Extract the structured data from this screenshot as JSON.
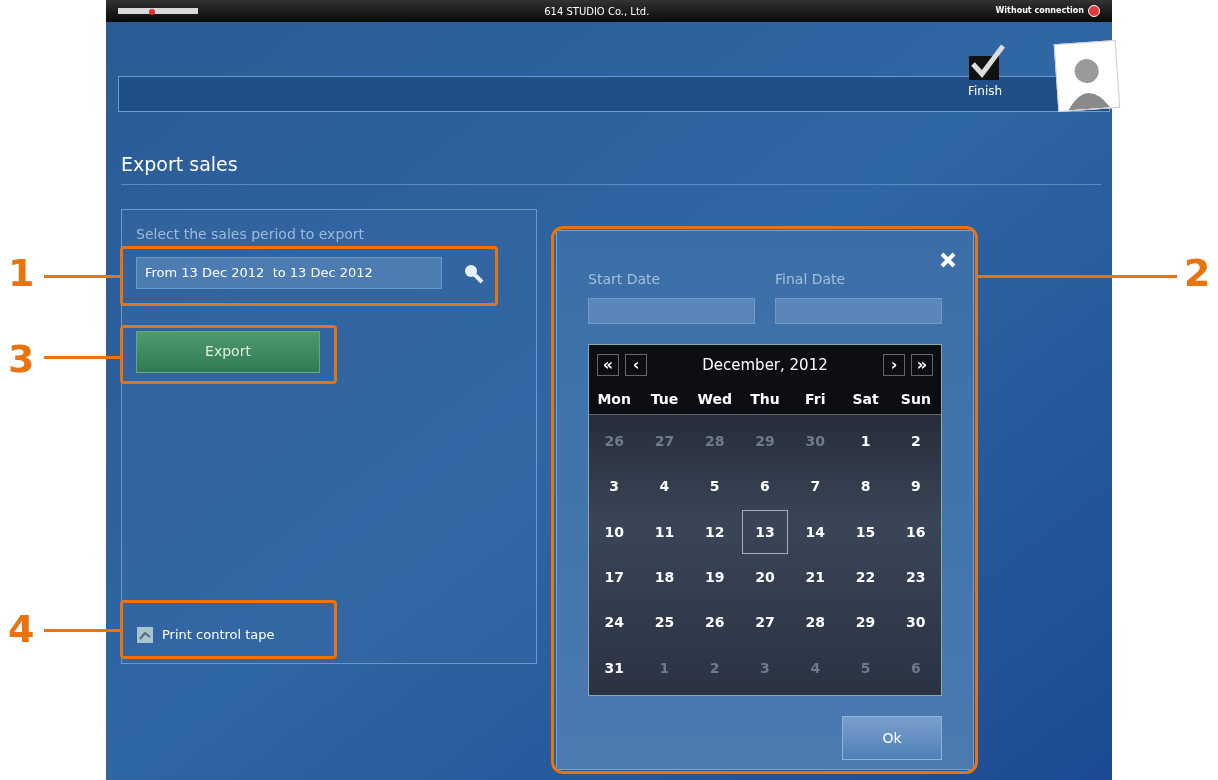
{
  "top_bar": {
    "company": "614 STUDIO Co., Ltd.",
    "connection": "Without connection"
  },
  "toolbar": {
    "finish": "Finish"
  },
  "page": {
    "title": "Export sales",
    "period_label": "Select the sales period to export",
    "period_value": "From 13 Dec 2012  to 13 Dec 2012",
    "export_button": "Export",
    "print_link": "Print control tape"
  },
  "date_popup": {
    "start_label": "Start Date",
    "final_label": "Final Date",
    "ok_button": "Ok",
    "calendar": {
      "first": "«",
      "prev": "‹",
      "month": "December, 2012",
      "next": "›",
      "last": "»",
      "weekdays": [
        "Mon",
        "Tue",
        "Wed",
        "Thu",
        "Fri",
        "Sat",
        "Sun"
      ],
      "weeks": [
        [
          {
            "day": "26",
            "outside": true,
            "selected": false
          },
          {
            "day": "27",
            "outside": true,
            "selected": false
          },
          {
            "day": "28",
            "outside": true,
            "selected": false
          },
          {
            "day": "29",
            "outside": true,
            "selected": false
          },
          {
            "day": "30",
            "outside": true,
            "selected": false
          },
          {
            "day": "1",
            "outside": false,
            "selected": false
          },
          {
            "day": "2",
            "outside": false,
            "selected": false
          }
        ],
        [
          {
            "day": "3",
            "outside": false,
            "selected": false
          },
          {
            "day": "4",
            "outside": false,
            "selected": false
          },
          {
            "day": "5",
            "outside": false,
            "selected": false
          },
          {
            "day": "6",
            "outside": false,
            "selected": false
          },
          {
            "day": "7",
            "outside": false,
            "selected": false
          },
          {
            "day": "8",
            "outside": false,
            "selected": false
          },
          {
            "day": "9",
            "outside": false,
            "selected": false
          }
        ],
        [
          {
            "day": "10",
            "outside": false,
            "selected": false
          },
          {
            "day": "11",
            "outside": false,
            "selected": false
          },
          {
            "day": "12",
            "outside": false,
            "selected": false
          },
          {
            "day": "13",
            "outside": false,
            "selected": true
          },
          {
            "day": "14",
            "outside": false,
            "selected": false
          },
          {
            "day": "15",
            "outside": false,
            "selected": false
          },
          {
            "day": "16",
            "outside": false,
            "selected": false
          }
        ],
        [
          {
            "day": "17",
            "outside": false,
            "selected": false
          },
          {
            "day": "18",
            "outside": false,
            "selected": false
          },
          {
            "day": "19",
            "outside": false,
            "selected": false
          },
          {
            "day": "20",
            "outside": false,
            "selected": false
          },
          {
            "day": "21",
            "outside": false,
            "selected": false
          },
          {
            "day": "22",
            "outside": false,
            "selected": false
          },
          {
            "day": "23",
            "outside": false,
            "selected": false
          }
        ],
        [
          {
            "day": "24",
            "outside": false,
            "selected": false
          },
          {
            "day": "25",
            "outside": false,
            "selected": false
          },
          {
            "day": "26",
            "outside": false,
            "selected": false
          },
          {
            "day": "27",
            "outside": false,
            "selected": false
          },
          {
            "day": "28",
            "outside": false,
            "selected": false
          },
          {
            "day": "29",
            "outside": false,
            "selected": false
          },
          {
            "day": "30",
            "outside": false,
            "selected": false
          }
        ],
        [
          {
            "day": "31",
            "outside": false,
            "selected": false
          },
          {
            "day": "1",
            "outside": true,
            "selected": false
          },
          {
            "day": "2",
            "outside": true,
            "selected": false
          },
          {
            "day": "3",
            "outside": true,
            "selected": false
          },
          {
            "day": "4",
            "outside": true,
            "selected": false
          },
          {
            "day": "5",
            "outside": true,
            "selected": false
          },
          {
            "day": "6",
            "outside": true,
            "selected": false
          }
        ]
      ]
    }
  },
  "callouts": [
    "1",
    "2",
    "3",
    "4"
  ]
}
